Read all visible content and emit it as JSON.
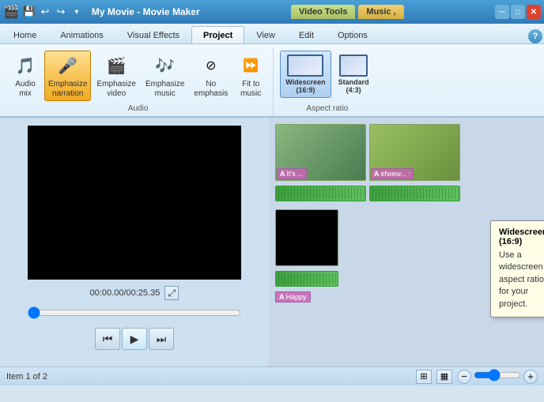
{
  "titlebar": {
    "title": "My Movie - Movie Maker",
    "tab_video": "Video Tools",
    "tab_music": "Music ,"
  },
  "quicktoolbar": {
    "icons": [
      "💾",
      "↩",
      "↪",
      "▾"
    ]
  },
  "ribbontabs": {
    "tabs": [
      "Home",
      "Animations",
      "Visual Effects",
      "Project",
      "View",
      "Edit",
      "Options"
    ]
  },
  "ribbon": {
    "audio_group_label": "Audio",
    "audio_buttons": [
      {
        "id": "audio-mix",
        "label": "Audio\nmix",
        "icon": "🎵"
      },
      {
        "id": "emphasize-narration",
        "label": "Emphasize\nnarration",
        "icon": "🎤",
        "active": true
      },
      {
        "id": "emphasize-video",
        "label": "Emphasize\nvideo",
        "icon": "🎬"
      },
      {
        "id": "emphasize-music",
        "label": "Emphasize\nmusic",
        "icon": "🎶"
      },
      {
        "id": "no-emphasis",
        "label": "No\nemphasis",
        "icon": "⛔"
      },
      {
        "id": "fit-to-music",
        "label": "Fit to\nmusic",
        "icon": "⏩"
      }
    ],
    "aspect_group_label": "Aspect ratio",
    "aspect_buttons": [
      {
        "id": "widescreen",
        "label": "Widescreen\n(16:9)",
        "active": true
      },
      {
        "id": "standard",
        "label": "Standard\n(4:3)"
      }
    ]
  },
  "preview": {
    "time": "00:00.00/00:25.35"
  },
  "tooltip": {
    "title": "Widescreen (16:9)",
    "body": "Use a widescreen aspect ratio for your project."
  },
  "storyboard": {
    "clips": [
      {
        "type": "video",
        "labels": [
          "A It's ...",
          "A efwew..."
        ]
      },
      {
        "type": "video",
        "labels": [
          "A Happy"
        ]
      }
    ]
  },
  "statusbar": {
    "text": "Item 1 of 2"
  }
}
